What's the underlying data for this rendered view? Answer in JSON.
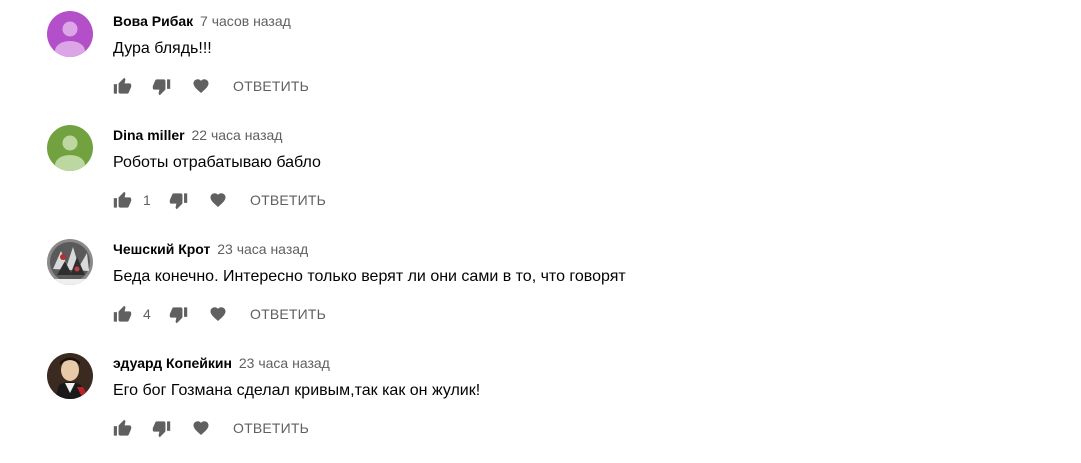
{
  "comments": [
    {
      "author": "Вова Рибак",
      "time": "7 часов назад",
      "text": "Дура блядь!!!",
      "likes": "",
      "reply_label": "ОТВЕТИТЬ",
      "avatar_icon": "default-user-avatar",
      "avatar_color": "#b34fc8"
    },
    {
      "author": "Dina miller",
      "time": "22 часа назад",
      "text": "Роботы отрабатываю бабло",
      "likes": "1",
      "reply_label": "ОТВЕТИТЬ",
      "avatar_icon": "default-user-avatar",
      "avatar_color": "#71a23f"
    },
    {
      "author": "Чешский Крот",
      "time": "23 часа назад",
      "text": "Беда конечно. Интересно только верят ли они сами в то, что говорят",
      "likes": "4",
      "reply_label": "ОТВЕТИТЬ",
      "avatar_icon": "photo-avatar",
      "avatar_color": "#6b6b6b"
    },
    {
      "author": "эдуард Копейкин",
      "time": "23 часа назад",
      "text": "Его бог Гозмана сделал кривым,так как он жулик!",
      "likes": "",
      "reply_label": "ОТВЕТИТЬ",
      "avatar_icon": "portrait-avatar",
      "avatar_color": "#3a2a20"
    }
  ],
  "icons": {
    "like": "thumbs-up-icon",
    "dislike": "thumbs-down-icon",
    "heart": "heart-icon"
  },
  "colors": {
    "icon": "#606060",
    "meta_text": "#606060",
    "text": "#030303"
  }
}
